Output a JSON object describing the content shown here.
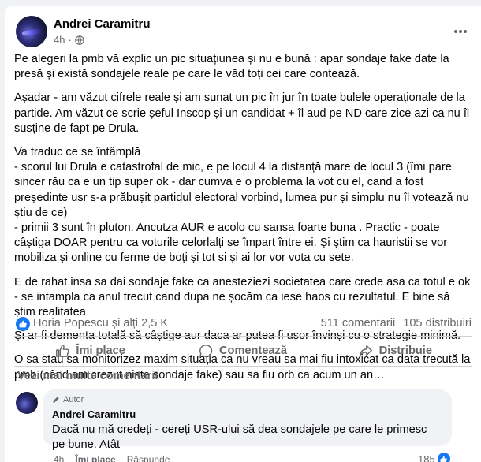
{
  "post": {
    "author": "Andrei Caramitru",
    "time": "4h",
    "paragraphs": [
      "Pe alegeri la pmb vă explic un pic situațiunea și nu e bună : apar sondaje fake date la presă și există sondajele reale pe care le văd toți cei care contează.",
      "Așadar - am văzut cifrele reale și am sunat un pic în jur în toate bulele operaționale de la partide. Am văzut ce scrie șeful Inscop și un candidat + îl aud pe ND care zice azi ca nu îl susține de fapt pe Drula.",
      "Va traduc ce se întâmplă\n- scorul lui Drula e catastrofal de mic, e pe locul 4 la distanță mare de locul 3 (îmi pare sincer rău ca e un tip super ok - dar cumva e o problema la vot cu el, cand a fost președinte usr s-a prăbușit partidul electoral vorbind, lumea pur și simplu nu îl votează nu știu de ce)\n- primii 3 sunt în pluton. Ancutza AUR e acolo cu sansa foarte buna . Practic - poate câștiga DOAR pentru ca voturile celorlalți se împart între ei. Și știm ca hauristii se vor mobiliza și online cu ferme de boți și tot si și ai lor vor vota cu sete.",
      "E de rahat insa sa dai sondaje fake ca anesteziezi societatea care crede asa ca totul e ok  - se intampla ca anul trecut cand dupa ne șocăm ca iese haos cu rezultatul. E bine să știm realitatea",
      "Și ar fi dementa totală să câștige aur daca ar putea fi ușor învinși cu o strategie minimă.",
      "O sa stau sa monitorizez maxim situația ca nu vreau sa mai fiu intoxicat ca data trecută la pmb (când am crezut niste sondaje fake) sau sa fiu orb ca acum un an…"
    ]
  },
  "reactions": {
    "summary": "Horia Popescu și alți 2,5 K",
    "comments": "511 comentarii",
    "shares": "105 distribuiri"
  },
  "actions": {
    "like": "Îmi place",
    "comment": "Comentează",
    "share": "Distribuie"
  },
  "view_more": "Vezi mai multe comentarii",
  "comment": {
    "badge": "Autor",
    "author": "Andrei Caramitru",
    "text": "Dacă nu mă credeți - cereți USR-ului să dea sondajele pe care le primesc pe bune. Atât",
    "time": "4h",
    "like": "Îmi place",
    "reply": "Răspunde",
    "likes": "185"
  },
  "colors": {
    "accent": "#1877f2",
    "secondary_text": "#65676b",
    "background": "#f0f2f5"
  }
}
